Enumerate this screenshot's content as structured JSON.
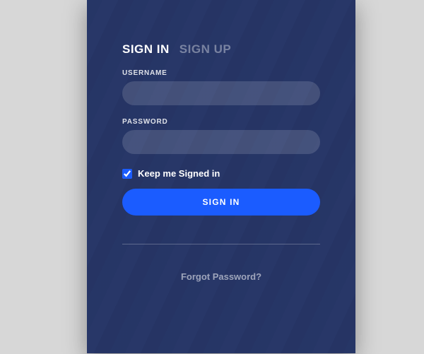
{
  "tabs": {
    "signin": "SIGN IN",
    "signup": "SIGN UP"
  },
  "fields": {
    "username_label": "USERNAME",
    "password_label": "PASSWORD"
  },
  "checkbox": {
    "label": "Keep me Signed in",
    "checked": true
  },
  "buttons": {
    "signin": "SIGN IN"
  },
  "links": {
    "forgot": "Forgot Password?"
  }
}
